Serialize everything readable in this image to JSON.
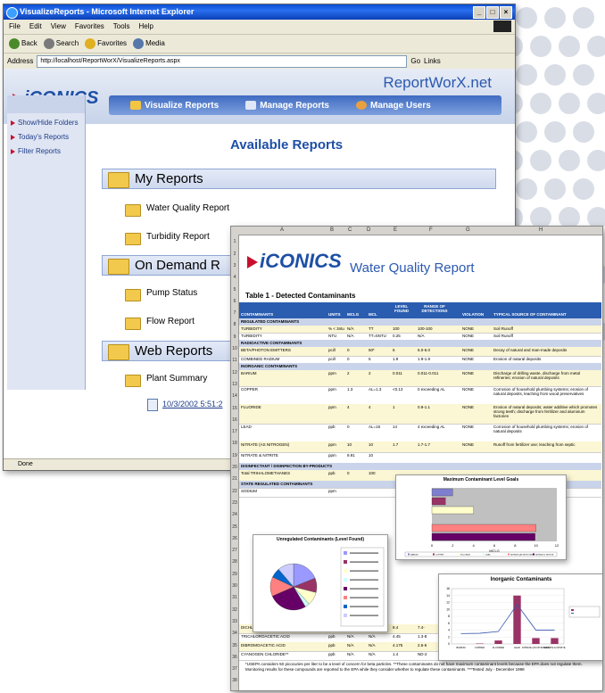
{
  "browser": {
    "title": "VisualizeReports - Microsoft Internet Explorer",
    "menu": [
      "File",
      "Edit",
      "View",
      "Favorites",
      "Tools",
      "Help"
    ],
    "toolbar": [
      "Back",
      "Search",
      "Favorites",
      "Media"
    ],
    "address_label": "Address",
    "address_value": "http://localhost/ReportWorX/VisualizeReports.aspx",
    "go_label": "Go",
    "links_label": "Links",
    "status": "Done"
  },
  "app": {
    "brand_title": "ReportWorX.net",
    "logo_text": "iCONICS",
    "nav": [
      "Visualize Reports",
      "Manage Reports",
      "Manage Users"
    ],
    "sidebar": [
      "Show/Hide Folders",
      "Today's Reports",
      "Filter Reports"
    ],
    "page_title": "Available Reports",
    "sections": [
      {
        "name": "My Reports",
        "items": [
          "Water Quality Report",
          "Turbidity Report"
        ]
      },
      {
        "name": "On Demand R",
        "items": [
          "Pump Status",
          "Flow Report"
        ]
      },
      {
        "name": "Web Reports",
        "items": [
          "Plant Summary"
        ]
      }
    ],
    "web_report_entry": "10/3/2002 5:51:2"
  },
  "sheet": {
    "columns": [
      "A",
      "B",
      "C",
      "D",
      "E",
      "F",
      "G",
      "H"
    ],
    "logo_text": "iCONICS",
    "title": "Water Quality Report",
    "table_title": "Table 1 - Detected Contaminants",
    "headers": [
      "CONTAMINANTS",
      "UNITS",
      "MCLG",
      "MCL",
      "LEVEL FOUND",
      "RANGE OF DETECTIONS",
      "VIOLATION",
      "TYPICAL SOURCE OF CONTAMINANT"
    ],
    "rows": [
      {
        "cat": true,
        "cells": [
          "REGULATED CONTAMINANTS"
        ]
      },
      {
        "cells": [
          "TURBIDITY",
          "% < 3ntu",
          "N/A",
          "TT",
          "100",
          "100-100",
          "NONE",
          "Soil Runoff"
        ],
        "yel": true
      },
      {
        "cells": [
          "TURBIDITY",
          "NTU",
          "N/A",
          "TT=5NTU",
          "0.25",
          "N/A",
          "NONE",
          "Soil Runoff"
        ]
      },
      {
        "cat": true,
        "cells": [
          "RADIOACTIVE CONTAMINANTS"
        ]
      },
      {
        "cells": [
          "BETA/PHOTON EMITTERS",
          "pci/l",
          "0",
          "50*",
          "6",
          "6.0-6.0",
          "NONE",
          "Decay of natural and man-made deposits"
        ],
        "yel": true
      },
      {
        "cells": [
          "COMBINED RADIUM",
          "pci/l",
          "0",
          "5",
          "1.9",
          "1.9-1.9",
          "NONE",
          "Erosion of natural deposits"
        ]
      },
      {
        "cat": true,
        "cells": [
          "INORGANIC CONTAMINANTS"
        ]
      },
      {
        "cells": [
          "BARIUM",
          "ppm",
          "2",
          "2",
          "0.011",
          "0.011-0.011",
          "NONE",
          "Discharge of drilling waste, discharge from metal refineries; erosion of natural deposits"
        ],
        "yel": true
      },
      {
        "cells": [
          "COPPER",
          "ppm",
          "1.3",
          "AL=1.3",
          "<0.13",
          "0 exceeding AL",
          "NONE",
          "Corrosion of household plumbing systems; erosion of natural deposits, leaching from wood preservatives"
        ]
      },
      {
        "cells": [
          "FLUORIDE",
          "ppm",
          "4",
          "4",
          "1",
          "0.9-1.1",
          "NONE",
          "Erosion of natural deposits; water additive which promotes strong teeth; discharge from fertilizer and aluminum factories"
        ],
        "yel": true
      },
      {
        "cells": [
          "LEAD",
          "ppb",
          "0",
          "AL=15",
          "14",
          "4 exceeding AL",
          "NONE",
          "Corrosion of household plumbing systems; erosion of natural deposits"
        ]
      },
      {
        "cells": [
          "NITRATE (AS NITROGEN)",
          "ppm",
          "10",
          "10",
          "1.7",
          "1.7-1.7",
          "NONE",
          "Runoff from fertilizer use; leaching from septic"
        ],
        "yel": true
      },
      {
        "cells": [
          "NITRATE & NITRITE",
          "ppm",
          "9.91",
          "10",
          "",
          "",
          "",
          ""
        ]
      },
      {
        "cat": true,
        "cells": [
          "DISINFECTANT / DISINFECTION BY-PRODUCTS"
        ]
      },
      {
        "cells": [
          "Total TRIHALOMETHANES",
          "ppb",
          "0",
          "100",
          "",
          "",
          "",
          ""
        ],
        "yel": true
      },
      {
        "cat": true,
        "cells": [
          "STATE REGULATED CONTAMINANTS"
        ]
      },
      {
        "cells": [
          "SODIUM",
          "ppm",
          "",
          "",
          "",
          "",
          "",
          ""
        ]
      }
    ],
    "lower_rows": [
      {
        "cells": [
          "DICHLOROACETIC ACID",
          "ppb",
          "N/A",
          "N/A",
          "8.4",
          "7.4-",
          ""
        ]
      },
      {
        "cells": [
          "TRICHLOROACETIC ACID",
          "ppb",
          "N/A",
          "N/A",
          "4.45",
          "1.3-8",
          ""
        ]
      },
      {
        "cells": [
          "DIBROMOACETIC ACID",
          "ppb",
          "N/A",
          "N/A",
          "4.175",
          "2.6-6",
          ""
        ]
      },
      {
        "cells": [
          "CYANOGEN CHLORIDE**",
          "ppb",
          "N/A",
          "N/A",
          "1.4",
          "ND-2",
          ""
        ]
      }
    ],
    "footnote": "*USEPA considers 50 picocuries per liter to be a level of concern for beta particles. **These contaminants do not have maximum contaminant levels because the EPA does not regulate them. Monitoring results for these compounds are reported to the EPA while they consider whether to regulate these contaminants. ***Tested July - December 1998"
  },
  "chart_data": [
    {
      "type": "bar",
      "title": "Maximum Contaminant Level Goals",
      "xlabel": "MCLG",
      "ylabel": "",
      "orientation": "horizontal",
      "categories": [
        "BARIUM",
        "COPPER",
        "FLUORIDE",
        "LEAD",
        "NITRATE (AS NITROGEN)",
        "NITRATE & NITRITE"
      ],
      "values": [
        2,
        1.3,
        4,
        0,
        10,
        9.91
      ],
      "xlim": [
        0,
        12
      ]
    },
    {
      "type": "pie",
      "title": "Unregulated Contaminants (Level Found)",
      "values": [
        8.4,
        4.45,
        4.175,
        1.4,
        12,
        6,
        3,
        5
      ]
    },
    {
      "type": "bar",
      "title": "Inorganic Contaminants",
      "categories": [
        "BARIUM",
        "COPPER",
        "FLUORIDE",
        "LEAD",
        "NITRATE (AS NITROGEN)",
        "NITRATE & NITRITE"
      ],
      "series": [
        {
          "values": [
            0.011,
            0.13,
            1,
            14,
            1.7,
            1.7
          ]
        }
      ],
      "ylim": [
        0,
        16
      ]
    }
  ]
}
